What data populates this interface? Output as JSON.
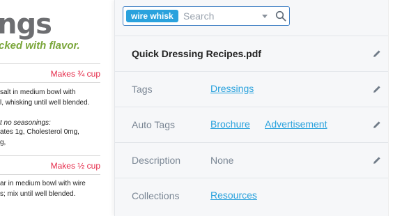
{
  "document": {
    "title_fragment": "ngs",
    "tagline_fragment": "cked with flavor.",
    "recipe1_makes": "Makes ¾ cup",
    "recipe1_line1": "salt in medium bowl with",
    "recipe1_line2": "l, whisking until well blended.",
    "recipe1_note": "t no seasonings:",
    "recipe1_nutrition1": "ates 1g, Cholesterol 0mg,",
    "recipe1_nutrition2": "g,",
    "recipe2_makes": "Makes ½ cup",
    "recipe2_line1": "ar in medium bowl with wire",
    "recipe2_line2": "s; mix until well blended."
  },
  "search": {
    "chip_label": "wire whisk",
    "placeholder": "Search",
    "value": ""
  },
  "details": {
    "filename": "Quick Dressing Recipes.pdf",
    "tags": {
      "label": "Tags",
      "items": [
        "Dressings"
      ]
    },
    "auto_tags": {
      "label": "Auto Tags",
      "items": [
        "Brochure",
        "Advertisement"
      ]
    },
    "description": {
      "label": "Description",
      "value": "None"
    },
    "collections": {
      "label": "Collections",
      "items": [
        "Resources"
      ]
    }
  },
  "icons": {
    "edit": "pencil-icon",
    "search": "magnifier-icon",
    "dropdown": "caret-down-icon"
  },
  "colors": {
    "accent": "#2aa2dd",
    "focus_border": "#3f7fc4",
    "makes_red": "#e52b4a",
    "tagline_green": "#7aa63a",
    "panel_bg": "#f6f7f9"
  }
}
